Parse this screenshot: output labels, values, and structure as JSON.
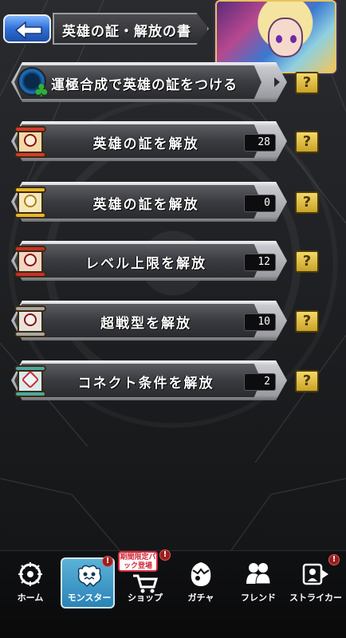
{
  "header": {
    "title": "英雄の証・解放の書",
    "back_icon": "back-arrow-icon"
  },
  "menu": {
    "items": [
      {
        "label": "運極合成で英雄の証をつける",
        "count": null,
        "icon": "clover-luck-icon",
        "help": "?"
      },
      {
        "label": "英雄の証を解放",
        "count": "28",
        "icon": "red-scroll-icon",
        "help": "?"
      },
      {
        "label": "英雄の証を解放",
        "count": "0",
        "icon": "gold-scroll-icon",
        "help": "?"
      },
      {
        "label": "レベル上限を解放",
        "count": "12",
        "icon": "red-scroll-icon",
        "help": "?"
      },
      {
        "label": "超戦型を解放",
        "count": "10",
        "icon": "silver-scroll-icon",
        "help": "?"
      },
      {
        "label": "コネクト条件を解放",
        "count": "2",
        "icon": "teal-scroll-icon",
        "help": "?"
      }
    ]
  },
  "nav": {
    "home": "ホーム",
    "monster": "モンスター",
    "shop": "ショップ",
    "gacha": "ガチャ",
    "friend": "フレンド",
    "striker": "ストライカー",
    "promo": "期間限定パック登場",
    "badge": "!"
  },
  "colors": {
    "accent_blue": "#2f6fd6",
    "help_gold": "#f4d868",
    "active_tab": "#2a83b8",
    "badge_red": "#9a1e1e"
  }
}
